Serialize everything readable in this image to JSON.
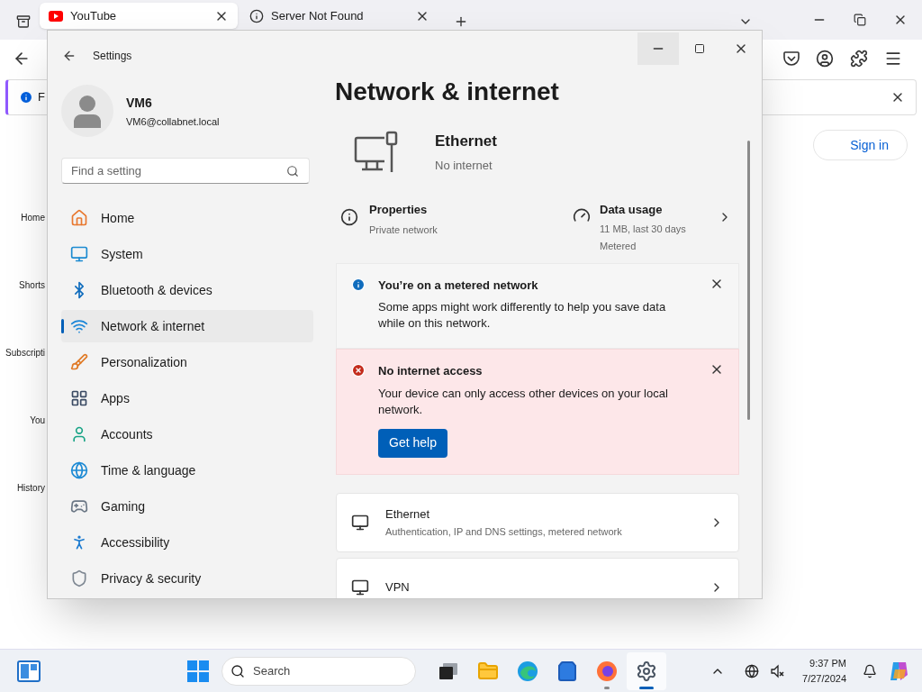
{
  "browser": {
    "tabs": [
      {
        "kind": "video",
        "title": "YouTube",
        "selected": true
      },
      {
        "kind": "error",
        "title": "Server Not Found",
        "selected": false
      }
    ],
    "info_bar": {
      "text": "F"
    },
    "page": {
      "sign_in": "Sign in",
      "sidebar": [
        "Home",
        "Shorts",
        "Subscripti",
        "You",
        "History"
      ]
    }
  },
  "settings": {
    "title": "Settings",
    "user": {
      "name": "VM6",
      "email": "VM6@collabnet.local"
    },
    "search": {
      "placeholder": "Find a setting"
    },
    "nav": [
      {
        "label": "Home",
        "selected": false
      },
      {
        "label": "System",
        "selected": false
      },
      {
        "label": "Bluetooth & devices",
        "selected": false
      },
      {
        "label": "Network & internet",
        "selected": true
      },
      {
        "label": "Personalization",
        "selected": false
      },
      {
        "label": "Apps",
        "selected": false
      },
      {
        "label": "Accounts",
        "selected": false
      },
      {
        "label": "Time & language",
        "selected": false
      },
      {
        "label": "Gaming",
        "selected": false
      },
      {
        "label": "Accessibility",
        "selected": false
      },
      {
        "label": "Privacy & security",
        "selected": false
      }
    ],
    "page_title": "Network & internet",
    "connection": {
      "name": "Ethernet",
      "status": "No internet"
    },
    "properties": {
      "title": "Properties",
      "subtitle": "Private network"
    },
    "data_usage": {
      "title": "Data usage",
      "lines": [
        "11 MB, last 30 days",
        "Metered"
      ]
    },
    "notices": [
      {
        "kind": "info",
        "title": "You’re on a metered network",
        "body": "Some apps might work differently to help you save data while on this network."
      },
      {
        "kind": "error",
        "title": "No internet access",
        "body": "Your device can only access other devices on your local network.",
        "button": "Get help"
      }
    ],
    "cards": [
      {
        "title": "Ethernet",
        "subtitle": "Authentication, IP and DNS settings, metered network"
      },
      {
        "title": "VPN"
      }
    ]
  },
  "taskbar": {
    "search_placeholder": "Search",
    "apps": [
      {
        "kind": "taskview",
        "active": false,
        "running": false
      },
      {
        "kind": "explorer",
        "active": false,
        "running": false
      },
      {
        "kind": "edge",
        "active": false,
        "running": false
      },
      {
        "kind": "store",
        "active": false,
        "running": false
      },
      {
        "kind": "firefox",
        "active": false,
        "running": true
      },
      {
        "kind": "settings",
        "active": true,
        "running": true
      }
    ],
    "time": "9:37 PM",
    "date": "7/27/2024"
  }
}
